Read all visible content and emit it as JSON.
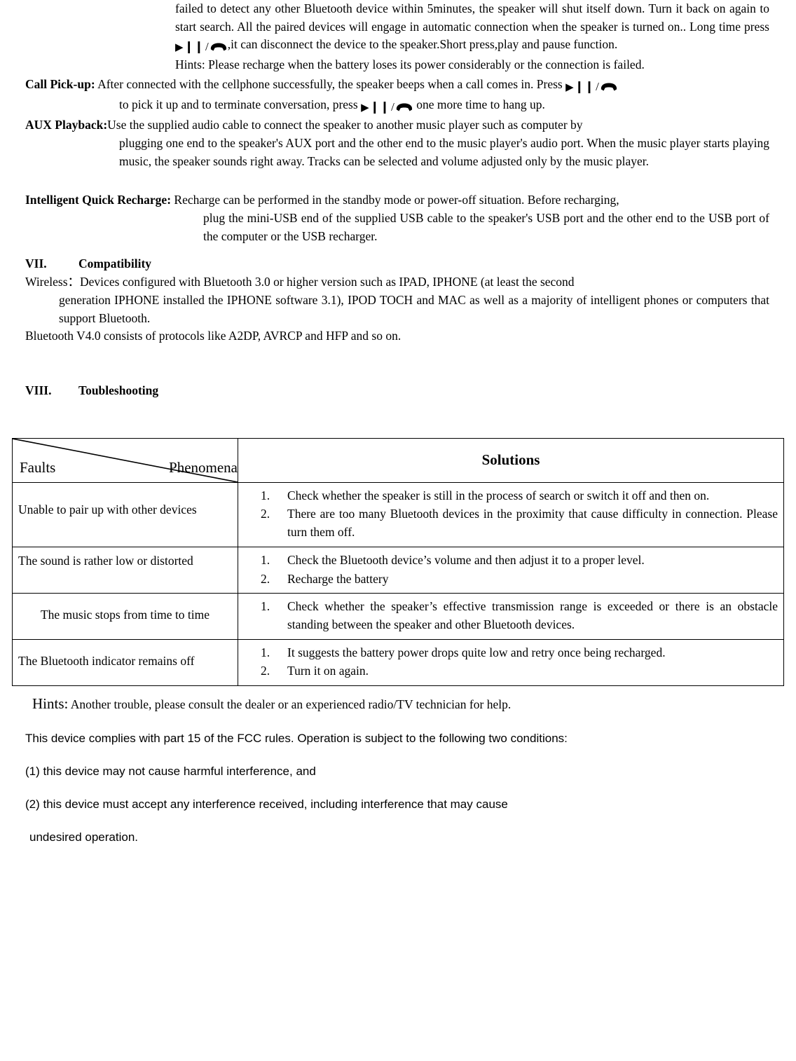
{
  "top": {
    "p1": "failed to detect any other Bluetooth device within 5minutes, the speaker will shut itself down. Turn it back on again to start search. All the paired devices will engage in automatic connection when the speaker is turned on.. Long time press",
    "p1b": ",it can disconnect the device to  the speaker.Short press,play and pause function.",
    "p2": "Hints: Please recharge when the battery loses its power considerably or the connection is failed."
  },
  "call_pickup": {
    "label": "Call Pick-up:",
    "text_a": "After connected with the cellphone successfully, the speaker beeps when a call comes in. Press",
    "text_b": "to pick it up and to terminate conversation, press",
    "text_c": "one more time to hang up."
  },
  "aux": {
    "label": "AUX Playback:",
    "text_a": "Use the supplied audio cable to connect the speaker to another music player such as computer by",
    "text_b": "plugging one end to the speaker's AUX port and the other end to the music player's audio port. When the music player starts playing music, the speaker sounds right away. Tracks can be selected and volume adjusted only by the music player."
  },
  "recharge": {
    "label": "Intelligent Quick Recharge:",
    "text_a": "Recharge can be performed in the standby mode or power-off situation. Before recharging,",
    "text_b": "plug the mini-USB end of the supplied USB cable to the speaker's USB port and the other end to the USB port of the computer or the USB recharger."
  },
  "compat": {
    "num": "VII.",
    "title": "Compatibility",
    "wireless_label": "Wireless：",
    "wireless_text_a": "Devices configured with Bluetooth 3.0 or higher version such as IPAD, IPHONE (at least the second",
    "wireless_text_b": "generation IPHONE installed the IPHONE software 3.1), IPOD TOCH and MAC as well as a majority of intelligent phones or computers that support Bluetooth.",
    "bt_line": "Bluetooth V4.0 consists of protocols like A2DP, AVRCP and HFP and so on."
  },
  "trouble": {
    "num": "VIII.",
    "title": "Toubleshooting"
  },
  "table": {
    "header_left_a": "Faults",
    "header_left_b": "Phenomena",
    "header_right": "Solutions",
    "rows": [
      {
        "fault": "Unable to pair up with other devices",
        "solutions": [
          "Check whether the speaker is still in the process of search or switch it off and then on.",
          "There are too many Bluetooth devices in the proximity that cause difficulty in connection. Please turn them off."
        ]
      },
      {
        "fault": "The sound is rather low or distorted",
        "solutions": [
          "Check the Bluetooth device’s volume and then adjust it to a proper level.",
          "Recharge the battery"
        ]
      },
      {
        "fault": "The music stops from time to time",
        "solutions": [
          "Check whether the speaker’s effective transmission range is exceeded or there is an obstacle standing between the speaker and other Bluetooth devices."
        ]
      },
      {
        "fault": "The Bluetooth indicator remains off",
        "solutions": [
          "It suggests the battery power drops quite low and retry once being recharged.",
          "Turn it on again."
        ]
      }
    ]
  },
  "bottom": {
    "hints_label": "Hints:",
    "hints_text": "Another trouble, please consult the dealer or an experienced radio/TV technician for help.",
    "fcc1": "This device complies with part 15 of the FCC rules. Operation is subject to the following two conditions:",
    "fcc2": "(1) this device may not cause harmful interference, and",
    "fcc3": "(2) this device must accept any interference received, including interference that may cause",
    "fcc4": "undesired operation."
  },
  "icons": {
    "play_pause": "play-pause-icon",
    "phone": "phone-handset-icon"
  }
}
